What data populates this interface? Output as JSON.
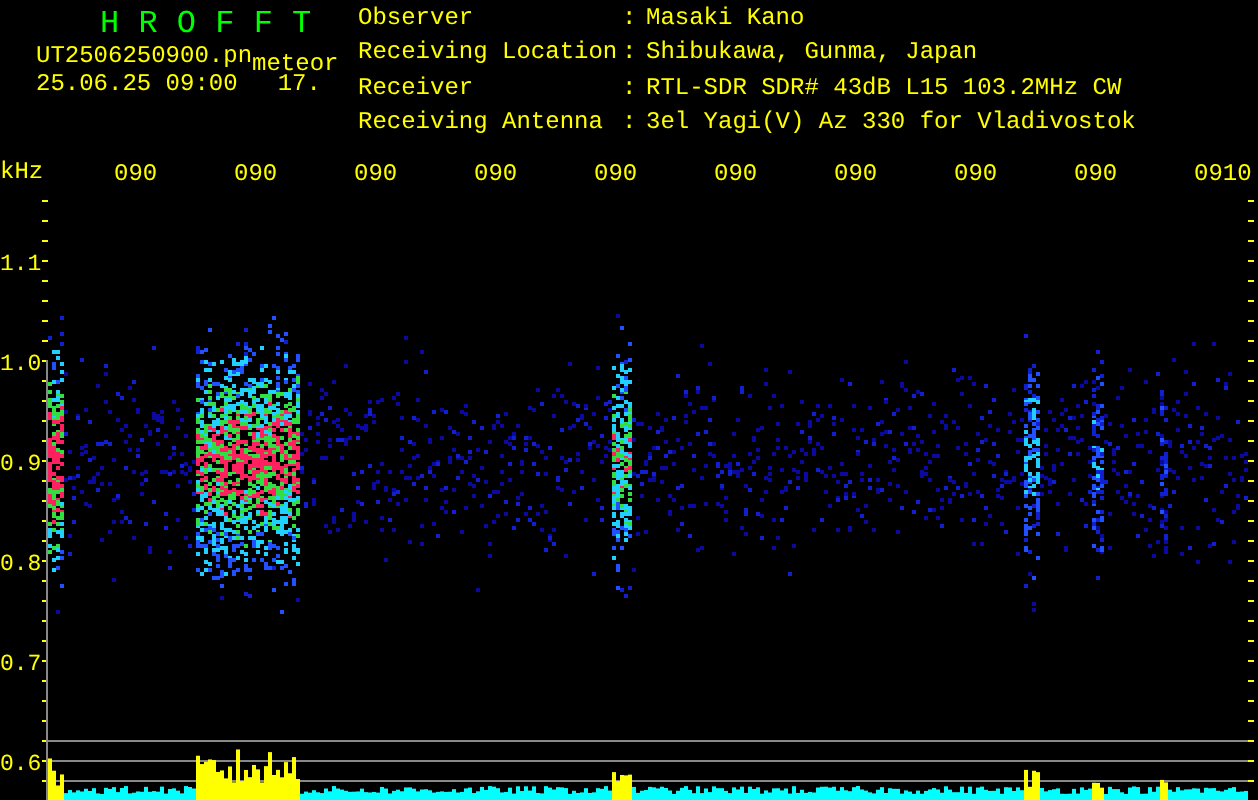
{
  "title": "H R O F F T",
  "file": {
    "name": "UT2506250900.pn",
    "tag": "meteor"
  },
  "datetime": "25.06.25 09:00",
  "count": "17.",
  "info": [
    {
      "label": "Observer",
      "sep": ":",
      "value": "Masaki Kano"
    },
    {
      "label": "Receiving Location",
      "sep": ":",
      "value": "Shibukawa, Gunma, Japan"
    },
    {
      "label": "Receiver",
      "sep": ":",
      "value": "RTL-SDR SDR# 43dB L15 103.2MHz CW"
    },
    {
      "label": "Receiving Antenna",
      "sep": ":",
      "value": "3el Yagi(V) Az 330 for Vladivostok"
    }
  ],
  "plot": {
    "unit": "kHz",
    "time_labels": [
      "090",
      "090",
      "090",
      "090",
      "090",
      "090",
      "090",
      "090",
      "090",
      "0910"
    ],
    "freq_labels": [
      "1.1",
      "1.0",
      "0.9",
      "0.8",
      "0.7",
      "0.6"
    ]
  }
}
